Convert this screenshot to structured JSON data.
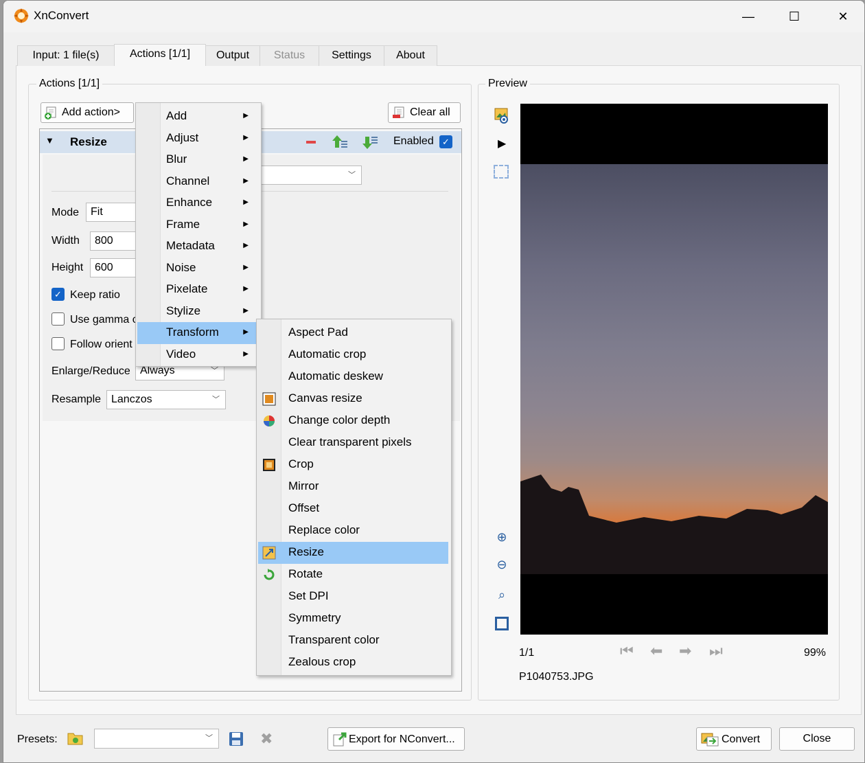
{
  "window": {
    "title": "XnConvert",
    "min": "—",
    "max": "☐",
    "close": "✕"
  },
  "tabs": [
    {
      "label": "Input: 1 file(s)"
    },
    {
      "label": "Actions [1/1]"
    },
    {
      "label": "Output"
    },
    {
      "label": "Status"
    },
    {
      "label": "Settings"
    },
    {
      "label": "About"
    }
  ],
  "actions_group": {
    "label": "Actions [1/1]",
    "add_action": "Add action>",
    "clear_all": "Clear all",
    "action": {
      "name": "Resize",
      "enabled_label": "Enabled",
      "enabled": true
    },
    "fields": {
      "mode_label": "Mode",
      "mode_value": "Fit",
      "width_label": "Width",
      "width_value": "800",
      "height_label": "Height",
      "height_value": "600",
      "keep_ratio_label": "Keep ratio",
      "use_gamma_label": "Use gamma c",
      "follow_orient_label": "Follow orient",
      "enlarge_label": "Enlarge/Reduce",
      "enlarge_value": "Always",
      "resample_label": "Resample",
      "resample_value": "Lanczos"
    }
  },
  "menu_main": [
    "Add",
    "Adjust",
    "Blur",
    "Channel",
    "Enhance",
    "Frame",
    "Metadata",
    "Noise",
    "Pixelate",
    "Stylize",
    "Transform",
    "Video"
  ],
  "menu_main_highlight": "Transform",
  "menu_transform": [
    "Aspect Pad",
    "Automatic crop",
    "Automatic deskew",
    "Canvas resize",
    "Change color depth",
    "Clear transparent pixels",
    "Crop",
    "Mirror",
    "Offset",
    "Replace color",
    "Resize",
    "Rotate",
    "Set DPI",
    "Symmetry",
    "Transparent color",
    "Zealous crop"
  ],
  "menu_transform_highlight": "Resize",
  "preview": {
    "label": "Preview",
    "counter": "1/1",
    "zoom": "99%",
    "filename": "P1040753.JPG"
  },
  "bottom": {
    "presets_label": "Presets:",
    "preset_value": "",
    "export": "Export for NConvert...",
    "convert": "Convert",
    "close": "Close"
  },
  "colors": {
    "highlight": "#99c9f6",
    "accent": "#1464c8",
    "action_header": "#d5e1ef"
  }
}
